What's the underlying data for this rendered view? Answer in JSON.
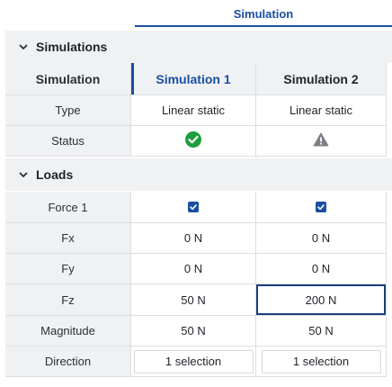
{
  "tab": {
    "label": "Simulation"
  },
  "sections": {
    "simulations": "Simulations",
    "loads": "Loads"
  },
  "header": {
    "label": "Simulation",
    "sim1": "Simulation 1",
    "sim2": "Simulation 2"
  },
  "rows": {
    "type": {
      "label": "Type",
      "sim1": "Linear static",
      "sim2": "Linear static"
    },
    "status": {
      "label": "Status",
      "sim1_icon": "check-circle-icon",
      "sim2_icon": "warning-triangle-icon"
    },
    "force1": {
      "label": "Force 1",
      "sim1_checked": true,
      "sim2_checked": true
    },
    "fx": {
      "label": "Fx",
      "sim1": "0 N",
      "sim2": "0 N"
    },
    "fy": {
      "label": "Fy",
      "sim1": "0 N",
      "sim2": "0 N"
    },
    "fz": {
      "label": "Fz",
      "sim1": "50 N",
      "sim2": "200 N"
    },
    "magnitude": {
      "label": "Magnitude",
      "sim1": "50 N",
      "sim2": "50 N"
    },
    "direction": {
      "label": "Direction",
      "sim1": "1 selection",
      "sim2": "1 selection"
    }
  },
  "colors": {
    "accent": "#1a4fa0",
    "success": "#1e9e3e",
    "warning": "#7b7f86",
    "section_bg": "#f0f1f3"
  }
}
